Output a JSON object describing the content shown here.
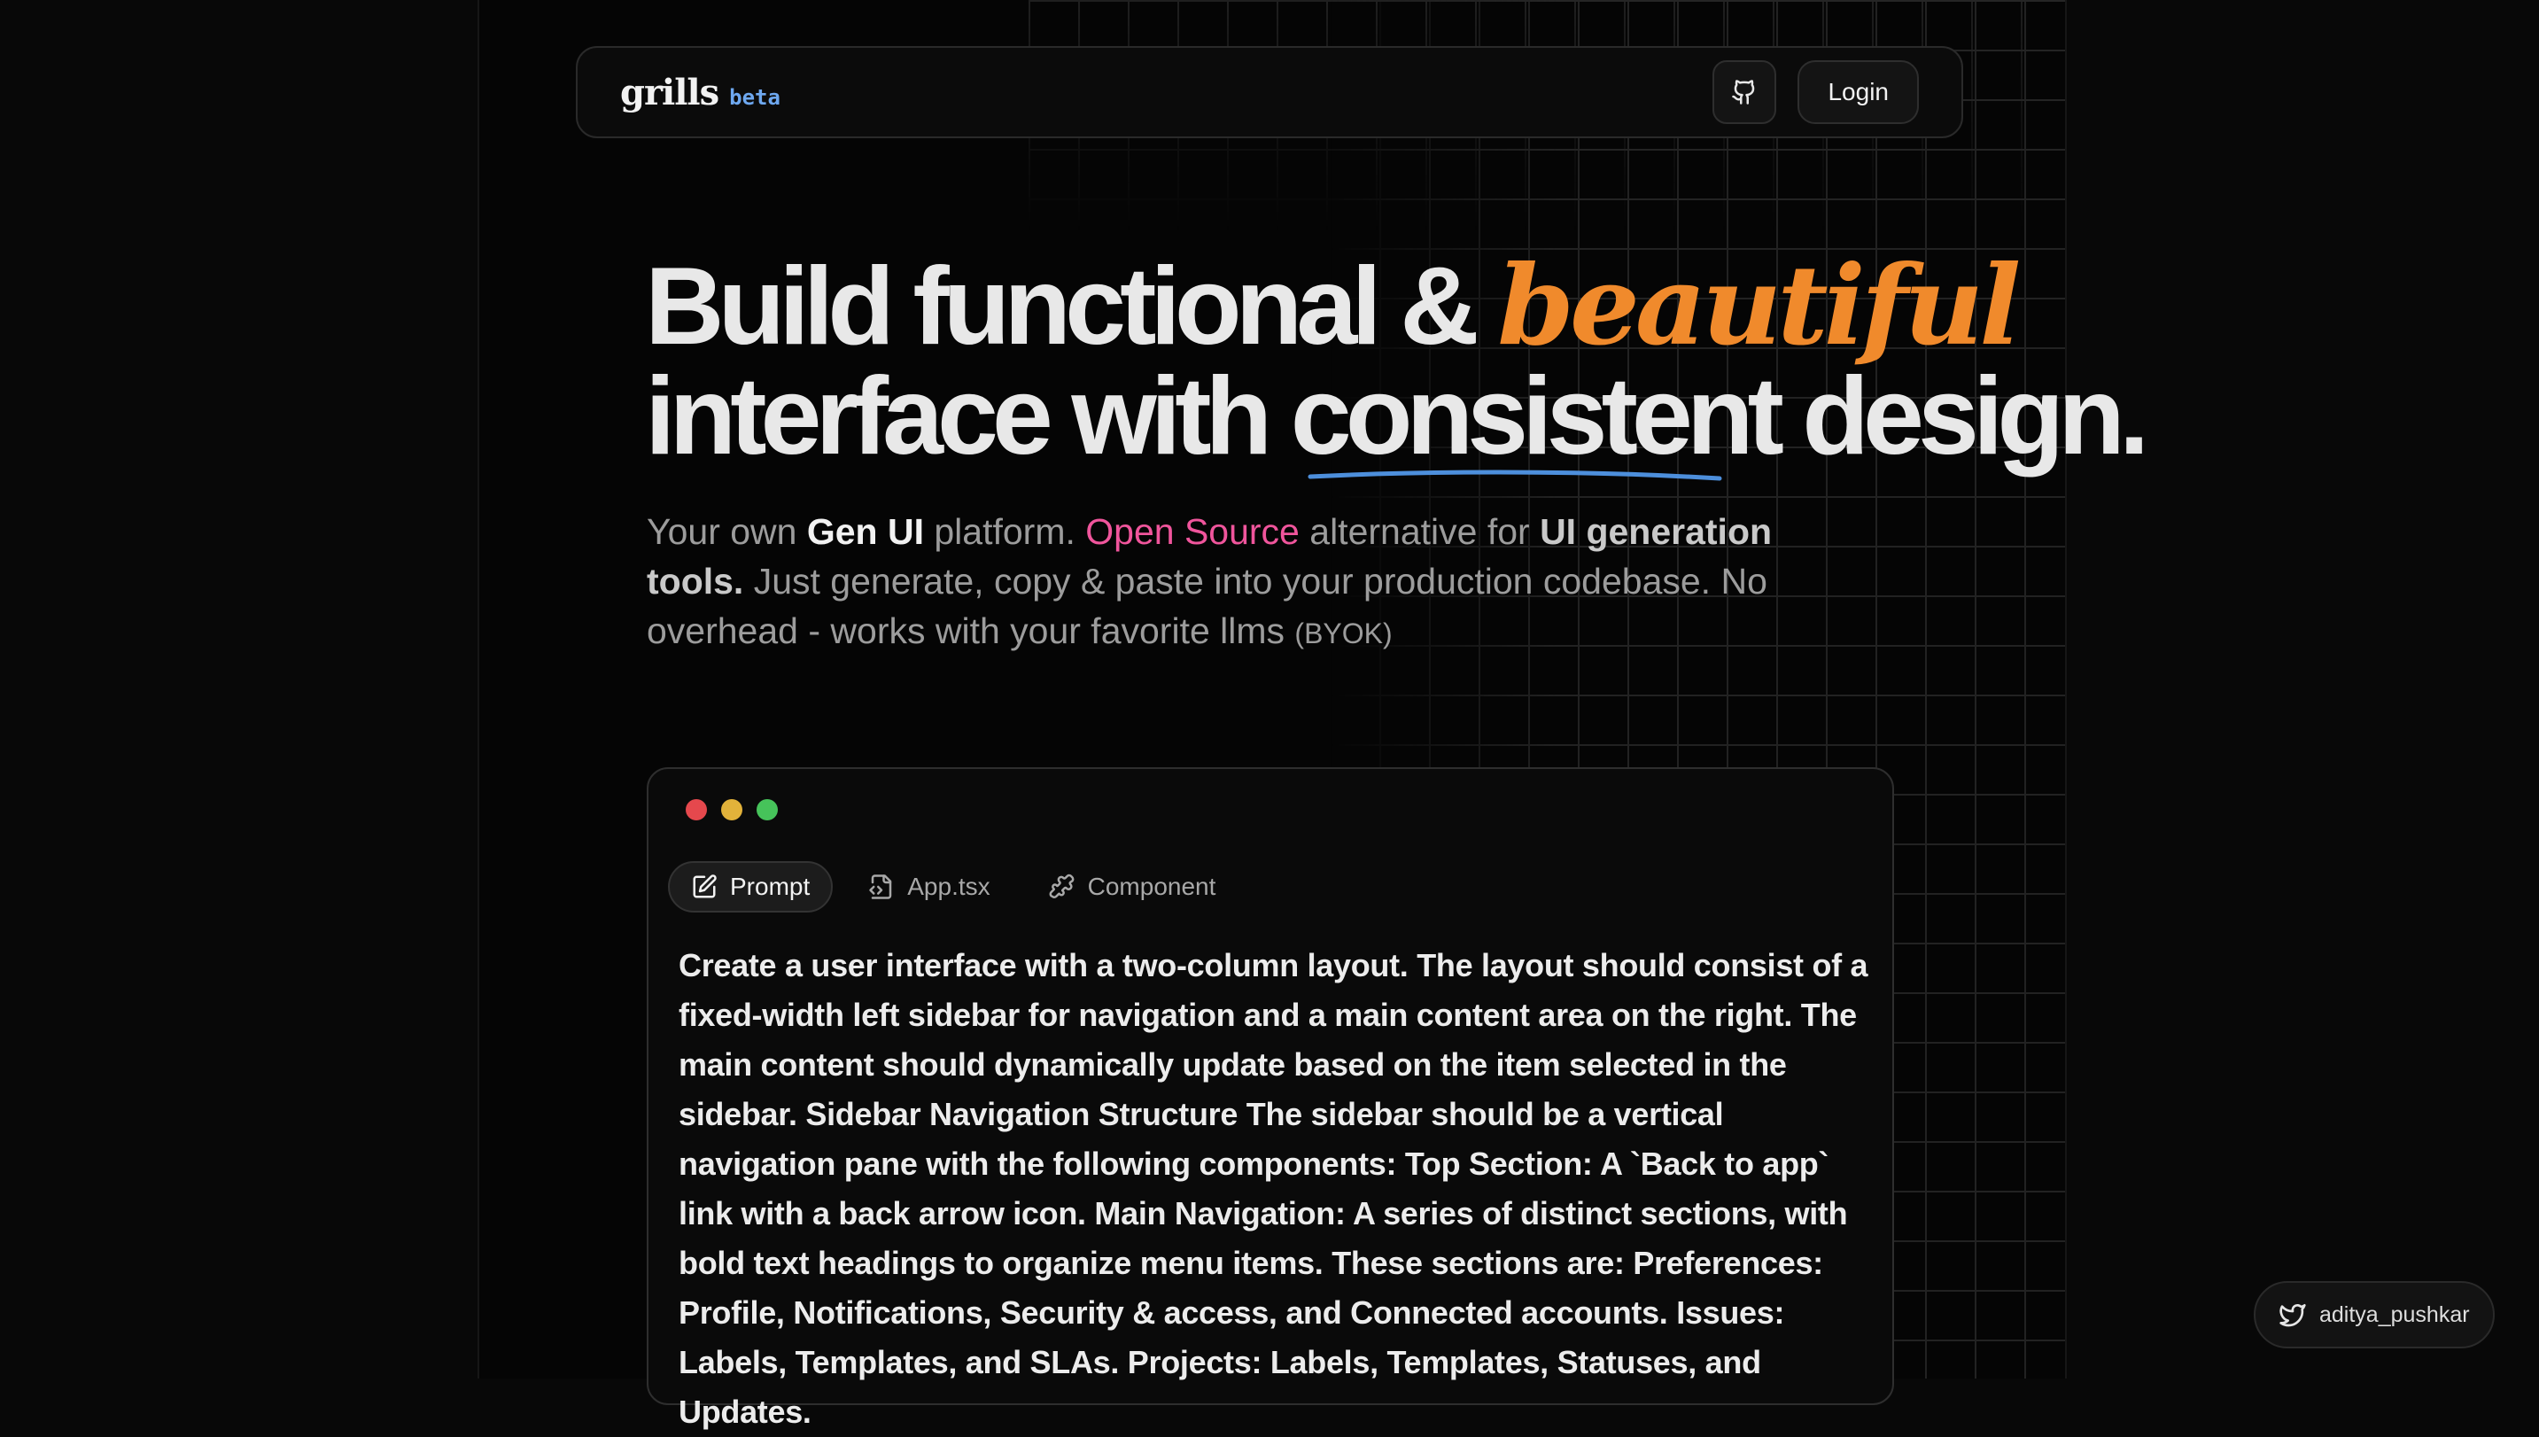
{
  "nav": {
    "brand": "grills",
    "tag": "beta",
    "login": "Login",
    "github_icon": "github-icon"
  },
  "hero": {
    "line1_start": "Build functional & ",
    "line1_accent": "beautiful",
    "line2_start": "interface with ",
    "line2_underlined": "consistent",
    "line2_end": " design.",
    "sub": {
      "t1": "Your own ",
      "b1": "Gen UI",
      "t2": " platform. ",
      "pink": "Open Source",
      "t3": " alternative for ",
      "b2": "UI generation tools.",
      "t4": " Just generate, copy & paste into your production codebase. No overhead - works with your favorite llms ",
      "small": "(BYOK)"
    },
    "accent_color": "#f08a2c",
    "link_color": "#f0559c"
  },
  "editor": {
    "tabs": [
      {
        "label": "Prompt",
        "icon": "edit-file-icon",
        "active": true
      },
      {
        "label": "App.tsx",
        "icon": "code-file-icon",
        "active": false
      },
      {
        "label": "Component",
        "icon": "puzzle-icon",
        "active": false
      }
    ],
    "prompt": "Create a user interface with a two-column layout. The layout should consist of a fixed-width left sidebar for navigation and a main content area on the right. The main content should dynamically update based on the item selected in the sidebar. Sidebar Navigation Structure The sidebar should be a vertical navigation pane with the following components: Top Section: A `Back to app` link with a back arrow icon. Main Navigation: A series of distinct sections, with bold text headings to organize menu items. These sections are: Preferences: Profile, Notifications, Security & access, and Connected accounts. Issues: Labels, Templates, and SLAs. Projects: Labels, Templates, Statuses, and Updates."
  },
  "footer": {
    "handle": "aditya_pushkar",
    "icon": "twitter-icon"
  }
}
